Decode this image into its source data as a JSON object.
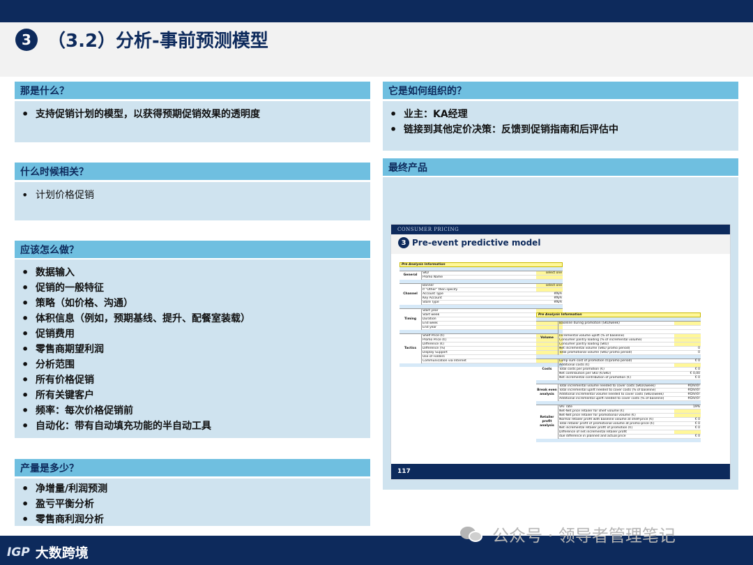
{
  "header": {
    "number": "3",
    "title": "（3.2）分析-事前预测模型"
  },
  "left": {
    "what": {
      "title": "那是什么？",
      "items": [
        "支持促销计划的模型，以获得预期促销效果的透明度"
      ]
    },
    "when": {
      "title": "什么时候相关？",
      "items": [
        "计划价格促销"
      ]
    },
    "how": {
      "title": "应该怎么做？",
      "items": [
        "数据输入",
        "促销的一般特征",
        "策略（如价格、沟通）",
        "体积信息（例如，预期基线、提升、配餐室装载）",
        "促销费用",
        "零售商期望利润",
        "分析范围",
        "所有价格促销",
        "所有关键客户",
        "频率：每次价格促销前",
        "自动化：带有自动填充功能的半自动工具"
      ]
    },
    "output": {
      "title": "产量是多少？",
      "items": [
        "净增量/利润预测",
        "盈亏平衡分析",
        "零售商利润分析"
      ]
    }
  },
  "right": {
    "org": {
      "title": "它是如何组织的？",
      "items": [
        "业主：KA经理",
        "链接到其他定价决策：反馈到促销指南和后评估中"
      ]
    },
    "product": {
      "title": "最终产品",
      "preview": {
        "topbar": "CONSUMER PRICING",
        "number": "3",
        "title": "Pre-event predictive model",
        "page": "117",
        "table1": {
          "head": "Pre Analysis Information",
          "groups": [
            {
              "name": "General",
              "rows": [
                [
                  "SKU",
                  "select one"
                ],
                [
                  "Promo Name",
                  ""
                ]
              ]
            },
            {
              "name": "Channel",
              "rows": [
                [
                  "Banner",
                  "select one"
                ],
                [
                  "If \"Other\" then specify",
                  ""
                ],
                [
                  "Account Type",
                  "#N/A"
                ],
                [
                  "Key Account",
                  "#N/A"
                ],
                [
                  "Store Type",
                  "#N/A"
                ]
              ]
            },
            {
              "name": "Timing",
              "rows": [
                [
                  "Start year",
                  ""
                ],
                [
                  "Start week",
                  ""
                ],
                [
                  "Duration",
                  ""
                ],
                [
                  "End week",
                  ""
                ],
                [
                  "End year",
                  ""
                ]
              ]
            },
            {
              "name": "Tactics",
              "rows": [
                [
                  "Shelf Price (€)",
                  ""
                ],
                [
                  "Promo Price (€)",
                  ""
                ],
                [
                  "Difference (€)",
                  ""
                ],
                [
                  "Difference (%)",
                  ""
                ],
                [
                  "Display Support",
                  ""
                ],
                [
                  "Use of Folders",
                  ""
                ],
                [
                  "Communication via Internet",
                  ""
                ]
              ]
            }
          ]
        },
        "table2": {
          "head": "Pre Analysis Information",
          "groups": [
            {
              "name": "Volume",
              "rows": [
                [
                  "Baseline during promotion (SKU/week)",
                  ""
                ],
                [
                  "",
                  ""
                ],
                [
                  "",
                  ""
                ],
                [
                  "Incremental volume uplift (% of baseline)",
                  ""
                ],
                [
                  "Consumer pantry loading (% of incremental volume)",
                  ""
                ],
                [
                  "Consumer pantry loading (SKU)",
                  ""
                ],
                [
                  "Net incremental volume (SKU/ promo period)",
                  "0"
                ],
                [
                  "Total promotional volume (SKU/ promo period)",
                  "0"
                ]
              ]
            },
            {
              "name": "Costs",
              "rows": [
                [
                  "Lump sum cost of promotion (€/promo period)",
                  "€ 0"
                ],
                [
                  "Additional costs (€)",
                  ""
                ],
                [
                  "Total costs per promotion (€)",
                  "€ 0"
                ],
                [
                  "Net contribution per SKU (€/SKU)",
                  "€ 0,00"
                ],
                [
                  "Net incremental contribution of promotion (€)",
                  "€ 0"
                ]
              ]
            },
            {
              "name": "Break even analysis",
              "rows": [
                [
                  "Total incremental volume needed to cover costs (SKUs/week)",
                  "#DIV/0!"
                ],
                [
                  "Total incremental uplift needed to cover costs (% of baseline)",
                  "#DIV/0!"
                ],
                [
                  "Additional incremental volume needed to cover costs (SKUs/week)",
                  "#DIV/0!"
                ],
                [
                  "Additional incremental uplift needed to cover costs (% of baseline)",
                  "#DIV/0!"
                ]
              ]
            },
            {
              "name": "Retailer profit analysis",
              "rows": [
                [
                  "VAT rate",
                  "19%"
                ],
                [
                  "Net-Net price retailer for shelf volume (€)",
                  ""
                ],
                [
                  "Net-Net price retailer for promotional volume (€)",
                  ""
                ],
                [
                  "Normal retailer profit with baseline volume at shelf-price (€)",
                  "€ 0"
                ],
                [
                  "Total retailer profit of promotional volume at promo-price (€)",
                  "€ 0"
                ],
                [
                  "Net incremental retailer profit of promotion (€)",
                  "€ 0"
                ],
                [
                  "Difference of net incremental retailer profit",
                  ""
                ],
                [
                  "due difference in planned and actual price",
                  "€ 0"
                ]
              ]
            }
          ]
        }
      }
    }
  },
  "footer": {
    "logo": "IGP",
    "brand": "大数跨境",
    "watermark": "公众号 · 领导者管理笔记"
  }
}
